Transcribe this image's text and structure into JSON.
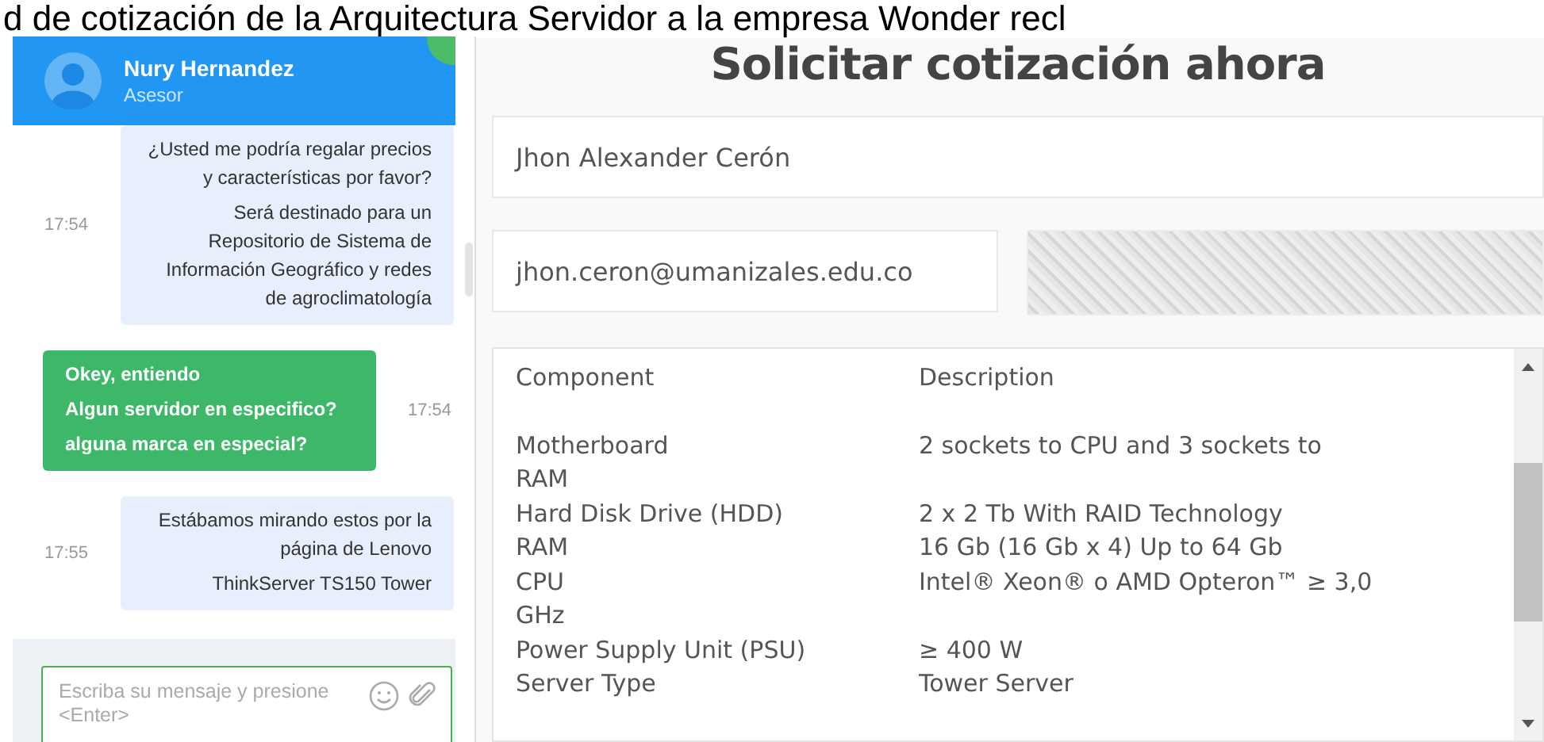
{
  "page_heading": "d de cotización de la Arquitectura Servidor a la empresa Wonder recl",
  "chat": {
    "agent": {
      "name": "Nury Hernandez",
      "role": "Asesor"
    },
    "messages": [
      {
        "kind": "sent",
        "paragraphs": [
          "¿Usted me podría regalar precios y características por favor?",
          "Será destinado para un Repositorio de Sistema de Información Geográfico y redes de agroclimatología"
        ],
        "time": "17:54"
      },
      {
        "kind": "received",
        "paragraphs": [
          "Okey, entiendo",
          "Algun servidor en especifico?",
          "alguna marca en especial?"
        ],
        "time": "17:54"
      },
      {
        "kind": "sent",
        "paragraphs": [
          "Estábamos mirando estos por la página de Lenovo",
          "ThinkServer TS150 Tower"
        ],
        "time": "17:55"
      }
    ],
    "input": {
      "placeholder": "Escriba su mensaje y presione <Enter>"
    }
  },
  "form": {
    "title": "Solicitar cotización ahora",
    "name_field": {
      "value": "Jhon Alexander Cerón"
    },
    "email_field": {
      "value": "jhon.ceron@umanizales.edu.co"
    },
    "details": {
      "columns": [
        "Component",
        "Description"
      ],
      "rows": [
        {
          "component": "Motherboard",
          "description": "2 sockets to CPU and 3 sockets to"
        },
        {
          "component": "RAM"
        },
        {
          "component": "Hard Disk Drive (HDD)",
          "description": "2 x 2 Tb With RAID Technology"
        },
        {
          "component": "RAM",
          "description": "16 Gb (16 Gb x 4) Up to 64 Gb"
        },
        {
          "component": "CPU",
          "description": "Intel® Xeon® o AMD Opteron™ ≥ 3,0"
        },
        {
          "component": "GHz"
        },
        {
          "component": "Power Supply Unit (PSU)",
          "description": "≥ 400 W"
        },
        {
          "component": "Server Type",
          "description": "Tower Server"
        }
      ]
    }
  }
}
